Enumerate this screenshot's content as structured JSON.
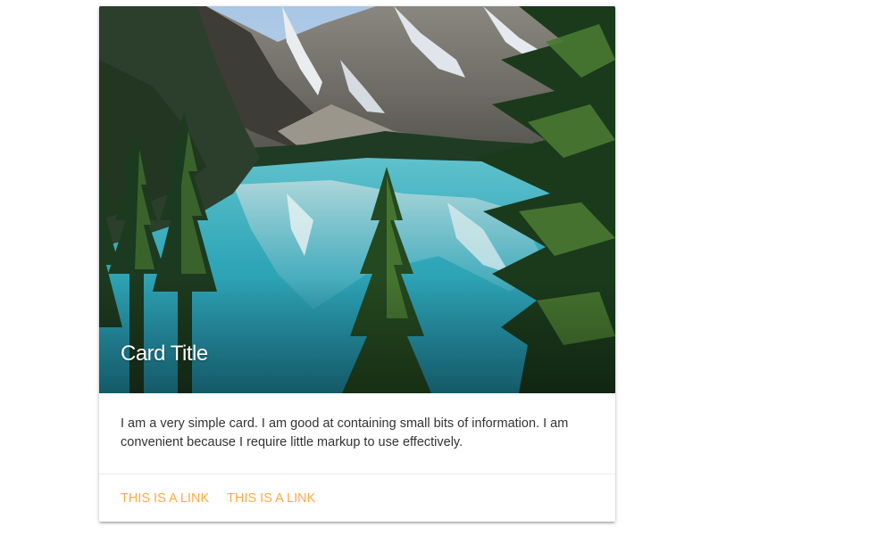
{
  "card": {
    "image": {
      "alt": "Mountain lake surrounded by pine trees",
      "icon": "landscape-photo"
    },
    "title": "Card Title",
    "content": "I am a very simple card. I am good at containing small bits of information. I am convenient because I require little markup to use effectively.",
    "actions": [
      {
        "label": "This is a link"
      },
      {
        "label": "This is a link"
      }
    ],
    "colors": {
      "link": "#ffab40",
      "text": "#333333",
      "background": "#ffffff"
    }
  }
}
